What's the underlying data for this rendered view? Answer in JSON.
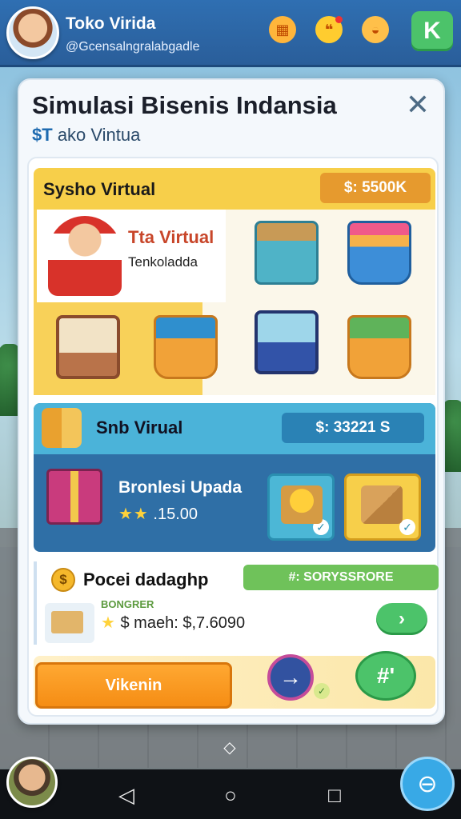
{
  "header": {
    "store_name": "Toko Virida",
    "handle": "@Gcensalngralabgadle",
    "icons": [
      "grid-icon",
      "chat-icon",
      "shop-icon"
    ],
    "k_label": "K"
  },
  "modal": {
    "title": "Simulasi Bisenis Indansia",
    "subtitle_currency": "$T",
    "subtitle_text": "ako Vintua",
    "close": "✕"
  },
  "section1": {
    "title": "Sysho Virtual",
    "price": "$: 5500K",
    "card_title": "Tta Virtual",
    "card_subtitle": "Tenkoladda",
    "items": [
      "teal-box",
      "blue-basket",
      "tv-stand",
      "yellow-basket",
      "machine",
      "veg-basket"
    ]
  },
  "section2": {
    "title": "Snb Virual",
    "price": "$: 33221 S",
    "product_name": "Bronlesi Upada",
    "rating_stars": "★★",
    "rating_value": ".15.00"
  },
  "section3": {
    "coin_symbol": "$",
    "title": "Pocei dadaghp",
    "badge": "#: SORYSSRORE",
    "label": "BONGRER",
    "stars": "★",
    "row_text": "$ maeh: $,7.6090",
    "go_symbol": "›"
  },
  "actions": {
    "primary": "Vikenin",
    "arrow": "→",
    "mini": "✓",
    "hash": "#'"
  },
  "nav": {
    "back": "◁",
    "home": "○",
    "recent": "□",
    "chevron": "◇"
  },
  "colors": {
    "header": "#2f6fb2",
    "accent_orange": "#f58d14",
    "accent_green": "#4cc36a",
    "accent_yellow": "#f7cf4a",
    "accent_blue": "#2f6fa6"
  }
}
